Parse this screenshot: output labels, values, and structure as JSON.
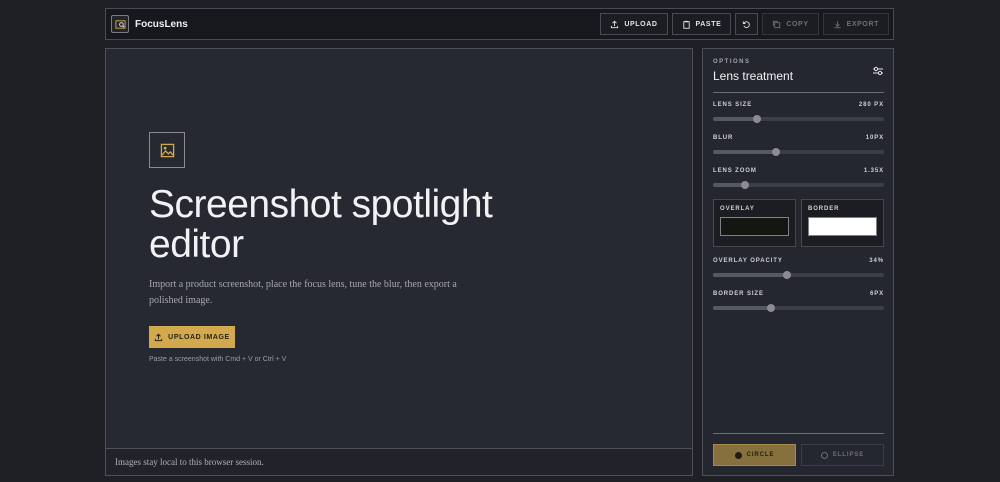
{
  "app": {
    "title": "FocusLens"
  },
  "toolbar": {
    "upload": "UPLOAD",
    "paste": "PASTE",
    "copy": "COPY",
    "export": "EXPORT"
  },
  "canvas": {
    "title": "Screenshot spotlight editor",
    "description": "Import a product screenshot, place the focus lens, tune the blur, then export a polished image.",
    "upload_button": "UPLOAD IMAGE",
    "paste_hint": "Paste a screenshot with Cmd + V or Ctrl + V",
    "footer": "Images stay local to this browser session."
  },
  "options": {
    "eyebrow": "OPTIONS",
    "title": "Lens treatment",
    "lens_size": {
      "label": "LENS SIZE",
      "value": "280 PX",
      "level": 0.26
    },
    "blur": {
      "label": "BLUR",
      "value": "10PX",
      "level": 0.37
    },
    "lens_zoom": {
      "label": "LENS ZOOM",
      "value": "1.35X",
      "level": 0.19
    },
    "overlay": {
      "label": "OVERLAY",
      "color": "#131711"
    },
    "border": {
      "label": "BORDER",
      "color": "#ffffff"
    },
    "overlay_opacity": {
      "label": "OVERLAY OPACITY",
      "value": "34%",
      "level": 0.43
    },
    "border_size": {
      "label": "BORDER SIZE",
      "value": "6PX",
      "level": 0.34
    },
    "shape_circle": "CIRCLE",
    "shape_ellipse": "ELLIPSE"
  },
  "colors": {
    "accent": "#d2a94c",
    "active_shape": "#86713e"
  }
}
